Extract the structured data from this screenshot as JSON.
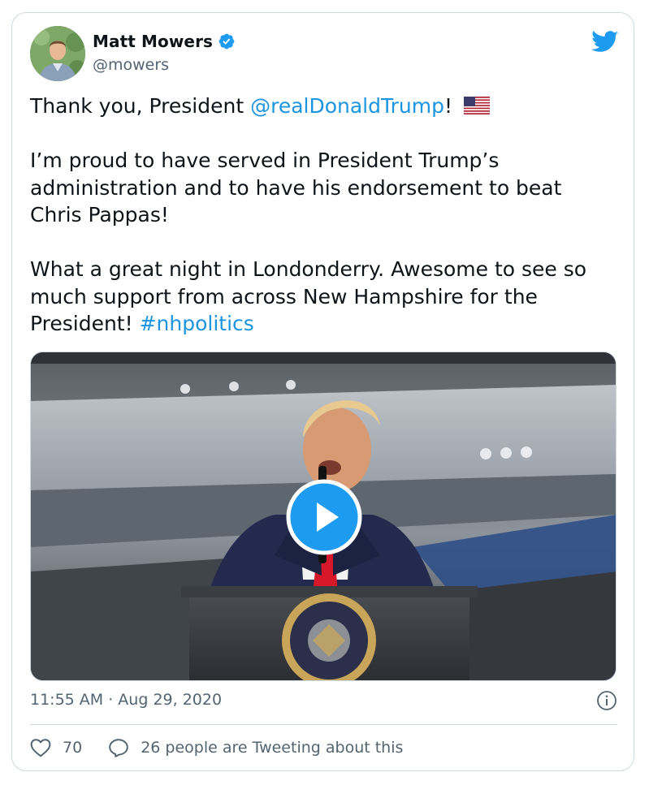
{
  "tweet": {
    "author": {
      "name": "Matt Mowers",
      "handle": "@mowers",
      "verified": true,
      "avatar_icon": "avatar-photo"
    },
    "text": {
      "line1_prefix": "Thank you, President ",
      "line1_mention": "@realDonaldTrump",
      "line1_suffix": "!",
      "flag_icon": "us-flag-emoji",
      "paragraph2": "I’m proud to have served in President Trump’s administration and to have his endorsement to beat Chris Pappas!",
      "paragraph3_text": "What a great night in Londonderry. Awesome to see so much support from across New Hampshire for the President! ",
      "paragraph3_hashtag": "#nhpolitics"
    },
    "media": {
      "type": "video",
      "play_icon": "play-icon"
    },
    "timestamp": "11:55 AM · Aug 29, 2020",
    "actions": {
      "like_count": "70",
      "reply_text": "26 people are Tweeting about this"
    },
    "colors": {
      "link": "#1b95e0",
      "twitter_blue": "#1d9bf0",
      "muted": "#536471",
      "border": "#cfd9de"
    }
  }
}
